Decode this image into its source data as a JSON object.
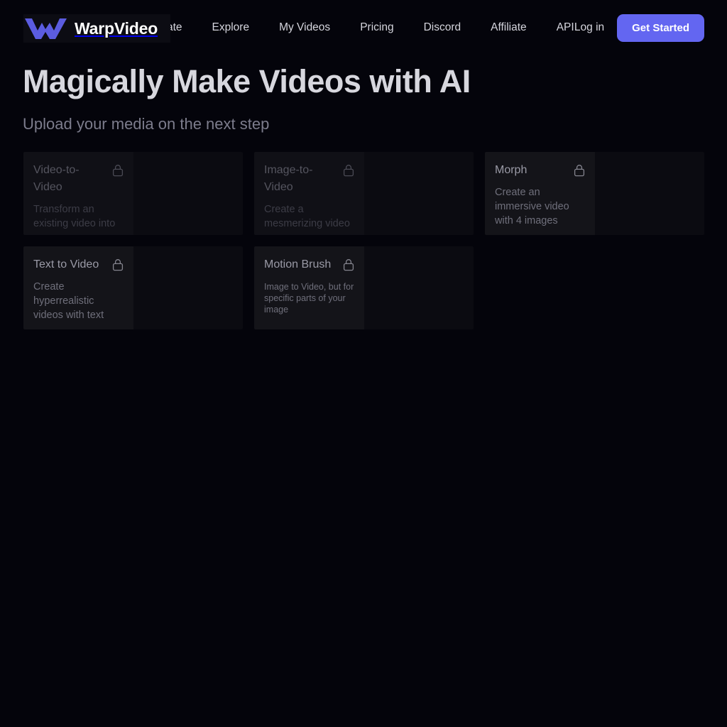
{
  "brand": {
    "name": "WarpVideo",
    "logo_icon": "warp-w-logo-icon",
    "logo_color": "#6366f1"
  },
  "nav": {
    "links": [
      {
        "label": "Create"
      },
      {
        "label": "Explore"
      },
      {
        "label": "My Videos"
      },
      {
        "label": "Pricing"
      },
      {
        "label": "Discord"
      },
      {
        "label": "Affiliate"
      },
      {
        "label": "API"
      }
    ],
    "login_label": "Log in",
    "cta_label": "Get Started",
    "cta_color": "#6366f1"
  },
  "hero": {
    "title": "Magically Make Videos with AI",
    "subtitle": "Upload your media on the next step"
  },
  "modes": {
    "cards": [
      {
        "title": "Video-to-Video",
        "description": "Transform an existing video into",
        "lock_icon": "lock-icon",
        "locked": true,
        "active": false,
        "compact": false
      },
      {
        "title": "Image-to-Video",
        "description": "Create a mesmerizing video",
        "lock_icon": "lock-icon",
        "locked": true,
        "active": false,
        "compact": false
      },
      {
        "title": "Morph",
        "description": "Create an immersive video with 4 images",
        "lock_icon": "lock-icon",
        "locked": true,
        "active": true,
        "compact": false
      },
      {
        "title": "Text to Video",
        "description": "Create hyperrealistic videos with text",
        "lock_icon": "lock-icon",
        "locked": true,
        "active": true,
        "compact": false
      },
      {
        "title": "Motion Brush",
        "description": "Image to Video, but for specific parts of your image",
        "lock_icon": "lock-icon",
        "locked": true,
        "active": true,
        "compact": true
      }
    ]
  },
  "colors": {
    "page_background": "#04040b",
    "card_outer": "#0b0b11",
    "card_inner": "#101016",
    "card_inner_active": "#141419",
    "accent": "#6366f1",
    "heading_text": "#d7d7de",
    "muted_text": "#7c7c8c"
  }
}
